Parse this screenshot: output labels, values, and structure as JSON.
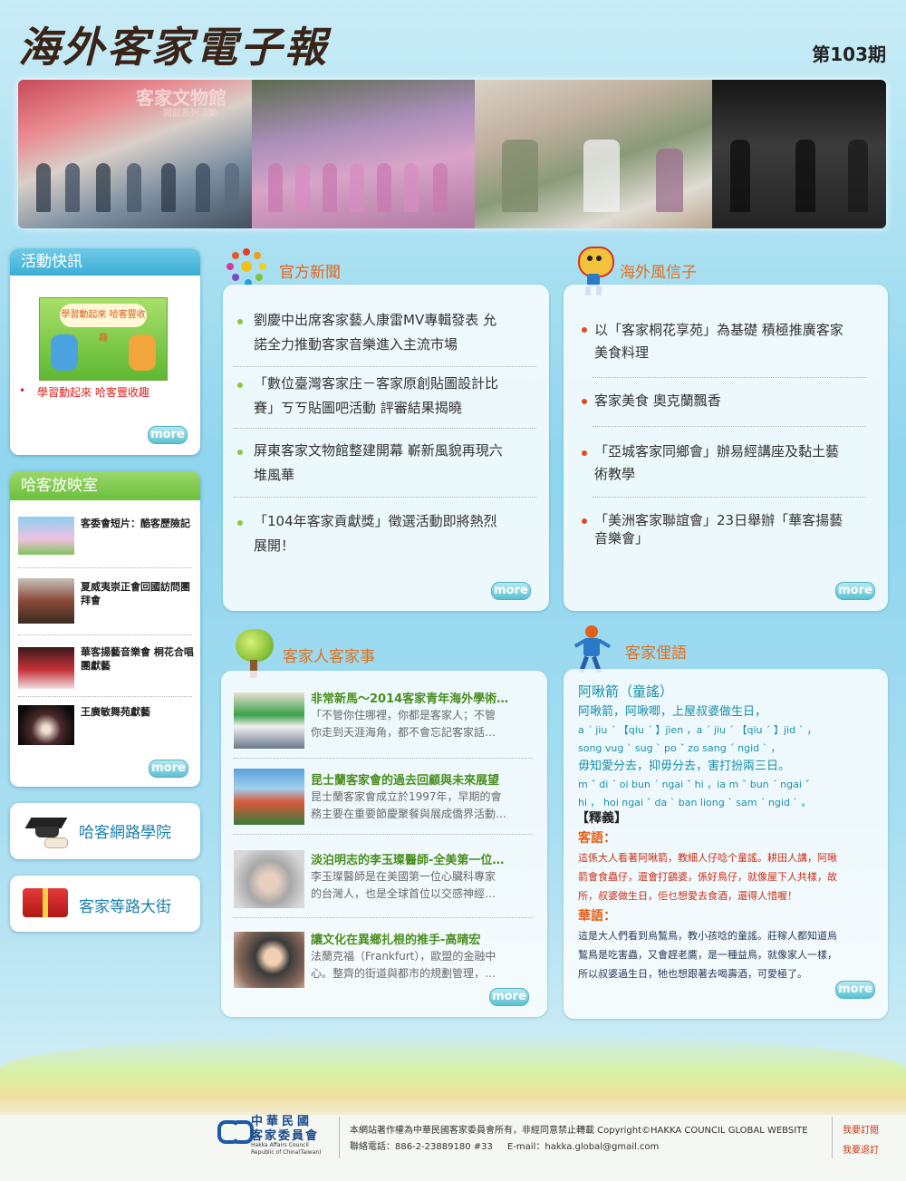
{
  "header": {
    "title": "海外客家電子報",
    "issue": "第103期"
  },
  "banner": {
    "sign_text": "客家文物館",
    "sign_sub": "開館系列活動"
  },
  "activity": {
    "title": "活動快訊",
    "promo": "學習動起來 哈客豐收趣",
    "item": "學習動起來 哈客豐收趣",
    "more": "more"
  },
  "screening": {
    "title": "哈客放映室",
    "items": [
      "客委會短片：酷客歷險記",
      "夏威夷崇正會回國訪問團拜會",
      "華客揚藝音樂會 桐花合唱團獻藝",
      "王廣敏舞苑獻藝"
    ],
    "more": "more"
  },
  "links": {
    "academy": "哈客網路學院",
    "street": "客家等路大街"
  },
  "official": {
    "title": "官方新聞",
    "items": [
      [
        "劉慶中出席客家藝人康雷MV專輯發表  允",
        "諾全力推動客家音樂進入主流市場"
      ],
      [
        "「數位臺灣客家庄－客家原創貼圖設計比",
        "賽」ㄎㄎ貼圖吧活動  評審結果揭曉"
      ],
      [
        "屏東客家文物館整建開幕  嶄新風貌再現六",
        "堆風華"
      ],
      [
        "「104年客家貢獻獎」徵選活動即將熱烈",
        "展開！"
      ]
    ],
    "more": "more"
  },
  "overseas": {
    "title": "海外風信子",
    "items": [
      [
        "以「客家桐花享苑」為基礎  積極推廣客家",
        "美食料理"
      ],
      [
        "客家美食  奧克蘭飄香"
      ],
      [
        "「亞城客家同鄉會」辦易經講座及黏土藝",
        "術教學"
      ],
      [
        "「美洲客家聯誼會」23日舉辦「華客揚藝",
        "音樂會」"
      ]
    ],
    "more": "more"
  },
  "people": {
    "title": "客家人客家事",
    "items": [
      {
        "title": "非常新馬～2014客家青年海外學術…",
        "lines": [
          "「不管你住哪裡，你都是客家人；不管",
          "你走到天涯海角，都不會忘記客家話…"
        ]
      },
      {
        "title": "昆士蘭客家會的過去回顧與未來展望",
        "lines": [
          "昆士蘭客家會成立於1997年，早期的會",
          "務主要在重要節慶聚餐與展成僑界活動…"
        ]
      },
      {
        "title": "淡泊明志的李玉璨醫師-全美第一位…",
        "lines": [
          "李玉璨醫師是在美國第一位心臟科專家",
          "的台灣人，也是全球首位以交感神經…"
        ]
      },
      {
        "title": "讓文化在異鄉扎根的推手-高晴宏",
        "lines": [
          "法蘭克福（Frankfurt），歐盟的金融中",
          "心。整齊的街道與都市的規劃管理，…"
        ]
      }
    ],
    "more": "more"
  },
  "proverb": {
    "title": "客家俚語",
    "name": "阿啾箭（童謠）",
    "l1": "阿啾箭，阿啾唧，上屋叔婆做生日，",
    "r1": "a ˊ  jiu ˊ 【qiu ˊ 】jien ，a ˊ  jiu ˊ 【qiu ˊ 】jid ˋ ，",
    "r2": "song vug ˋ  sug ˋ  po ˇ zo sang ˊ  ngid ˋ ，",
    "l2": "毋知愛分去，抑毋分去，害打扮兩三日。",
    "r3": "m ˇ  di ˊ  oi bun ˊ  ngai ˇ  hi ，ia m ˇ  bun ˊ  ngai ˇ",
    "r4": "hi ， hoi ngai ˇ  da ˋ  ban liong ˋ  sam ˊ  ngid ˋ 。",
    "meaning": "【釋義】",
    "hakka": "客語：",
    "hakka_lines": [
      "這係大人看著阿啾箭，教細人仔唸个童謠。耕田人講，阿啾",
      "箭會食蟲仔，還會打鷂婆，係好鳥仔，就像屋下人共樣，故",
      "所，叔婆做生日，佢乜想愛去食酒，還得人惜喔！"
    ],
    "mandarin": "華語：",
    "mandarin_lines": [
      "這是大人們看到烏鶖鳥，教小孩唸的童謠。莊稼人都知道烏",
      "鶖鳥是吃害蟲，又會趕老鷹，是一種益鳥，就像家人一樣，",
      "所以叔婆過生日，牠也想跟著去喝壽酒，可愛極了。"
    ],
    "more": "more"
  },
  "footer": {
    "org1": "中華民國",
    "org2": "客家委員會",
    "org_en1": "Hakka Affairs Council",
    "org_en2": "Republic of China(Taiwan)",
    "copyright": "本網站著作權為中華民國客家委員會所有，非經同意禁止轉載 Copyright©HAKKA COUNCIL GLOBAL WEBSITE",
    "phone": "聯絡電話：886-2-23889180 #33",
    "email": "E-mail：hakka.global@gmail.com",
    "subscribe": "我要訂閱",
    "unsubscribe": "我要退訂"
  }
}
